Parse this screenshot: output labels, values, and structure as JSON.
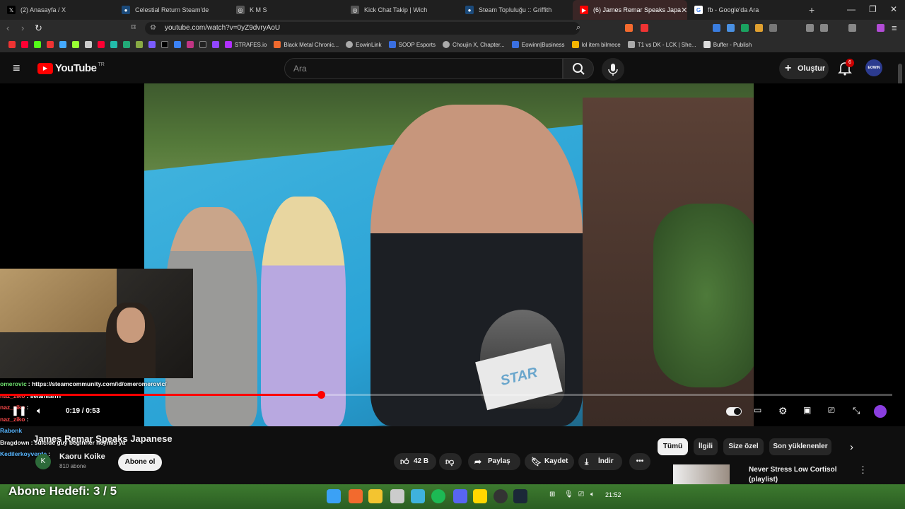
{
  "browser": {
    "tabs": [
      {
        "label": "(2) Anasayfa / X",
        "icon": "x-icon",
        "active": false
      },
      {
        "label": "Celestial Return Steam'de",
        "icon": "steam-icon",
        "active": false
      },
      {
        "label": "K M S",
        "icon": "globe-icon",
        "active": false
      },
      {
        "label": "Kick Chat Takip | Wich",
        "icon": "globe-icon",
        "active": false
      },
      {
        "label": "Steam Topluluğu :: Griffith",
        "icon": "steam-icon",
        "active": false
      },
      {
        "label": "(6) James Remar Speaks Japa",
        "icon": "youtube-icon",
        "active": true
      },
      {
        "label": "fb - Google'da Ara",
        "icon": "google-icon",
        "active": false
      }
    ],
    "new_tab": "+",
    "url": "youtube.com/watch?v=0yZ9dvryAoU",
    "bookmarks": [
      {
        "label": "STRAFES.io"
      },
      {
        "label": "Black Metal Chronic..."
      },
      {
        "label": "EowinLink"
      },
      {
        "label": "SOOP Esports"
      },
      {
        "label": "Choujin X, Chapter..."
      },
      {
        "label": "Eowinn|Business"
      },
      {
        "label": "lol item bilmece"
      },
      {
        "label": "T1 vs DK - LCK | She..."
      },
      {
        "label": "Buffer - Publish"
      }
    ]
  },
  "youtube": {
    "logo": "YouTube",
    "region": "TR",
    "search_placeholder": "Ara",
    "create_label": "Oluştur",
    "notification_count": "6",
    "avatar_text": "EOWIN"
  },
  "player": {
    "time": "0:19 / 0:53",
    "progress": 0.36,
    "mic_flag": "STAR"
  },
  "chat": [
    {
      "user": "omerovic",
      "text": ": https://steamcommunity.com/id/omeromerovic/",
      "color": "#6fe36f"
    },
    {
      "user": "naz_ziko",
      "text": ": selamlarrrr",
      "color": "#ff4a4a"
    },
    {
      "user": "naz_ziko",
      "text": ":",
      "color": "#ff4a4a"
    },
    {
      "user": "naz_ziko",
      "text": ":",
      "color": "#ff4a4a"
    },
    {
      "user": "Rabonk",
      "text": "",
      "color": "#58b6ff"
    },
    {
      "user": "Bragdown",
      "text": ": suicide guy beginner neymis ya",
      "color": "#f1f1f1"
    },
    {
      "user": "Kedilerkoyverde",
      "text": ":",
      "color": "#58b6ff"
    }
  ],
  "video": {
    "title": "James Remar Speaks Japanese",
    "channel": "Kaoru Koike",
    "channel_initial": "K",
    "subs": "810 abone",
    "subscribe_label": "Abone ol",
    "likes": "42 B",
    "share_label": "Paylaş",
    "save_label": "Kaydet",
    "download_label": "İndir"
  },
  "chips": [
    "Tümü",
    "İlgili",
    "Size özel",
    "Son yüklenenler"
  ],
  "recommendation": {
    "title": "Never Stress Low Cortisol (playlist)"
  },
  "overlay": {
    "goal": "Abone Hedefi:  3 / 5"
  },
  "taskbar": {
    "clock": "21:52"
  }
}
